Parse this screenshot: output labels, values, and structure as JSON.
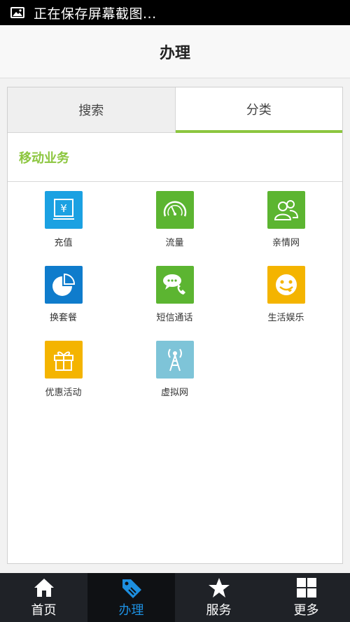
{
  "status_bar": {
    "text": "正在保存屏幕截图..."
  },
  "header": {
    "title": "办理"
  },
  "tabs": [
    {
      "label": "搜索",
      "active": false
    },
    {
      "label": "分类",
      "active": true
    }
  ],
  "section": {
    "title": "移动业务"
  },
  "services": [
    {
      "label": "充值",
      "icon": "recharge-icon",
      "color": "#1ba1e2"
    },
    {
      "label": "流量",
      "icon": "speedometer-icon",
      "color": "#5cb531"
    },
    {
      "label": "亲情网",
      "icon": "family-icon",
      "color": "#5cb531"
    },
    {
      "label": "换套餐",
      "icon": "pie-chart-icon",
      "color": "#0f7ccc"
    },
    {
      "label": "短信通话",
      "icon": "chat-phone-icon",
      "color": "#5cb531"
    },
    {
      "label": "生活娱乐",
      "icon": "smiley-icon",
      "color": "#f4b400"
    },
    {
      "label": "优惠活动",
      "icon": "gift-icon",
      "color": "#f4b400"
    },
    {
      "label": "虚拟网",
      "icon": "antenna-icon",
      "color": "#7ec4d8"
    }
  ],
  "bottom_nav": [
    {
      "label": "首页",
      "icon": "home-icon",
      "active": false
    },
    {
      "label": "办理",
      "icon": "tag-icon",
      "active": true
    },
    {
      "label": "服务",
      "icon": "star-icon",
      "active": false
    },
    {
      "label": "更多",
      "icon": "grid-icon",
      "active": false
    }
  ],
  "colors": {
    "accent_green": "#8cc63f",
    "active_blue": "#1d8fe0",
    "nav_bg": "#1f2227"
  }
}
